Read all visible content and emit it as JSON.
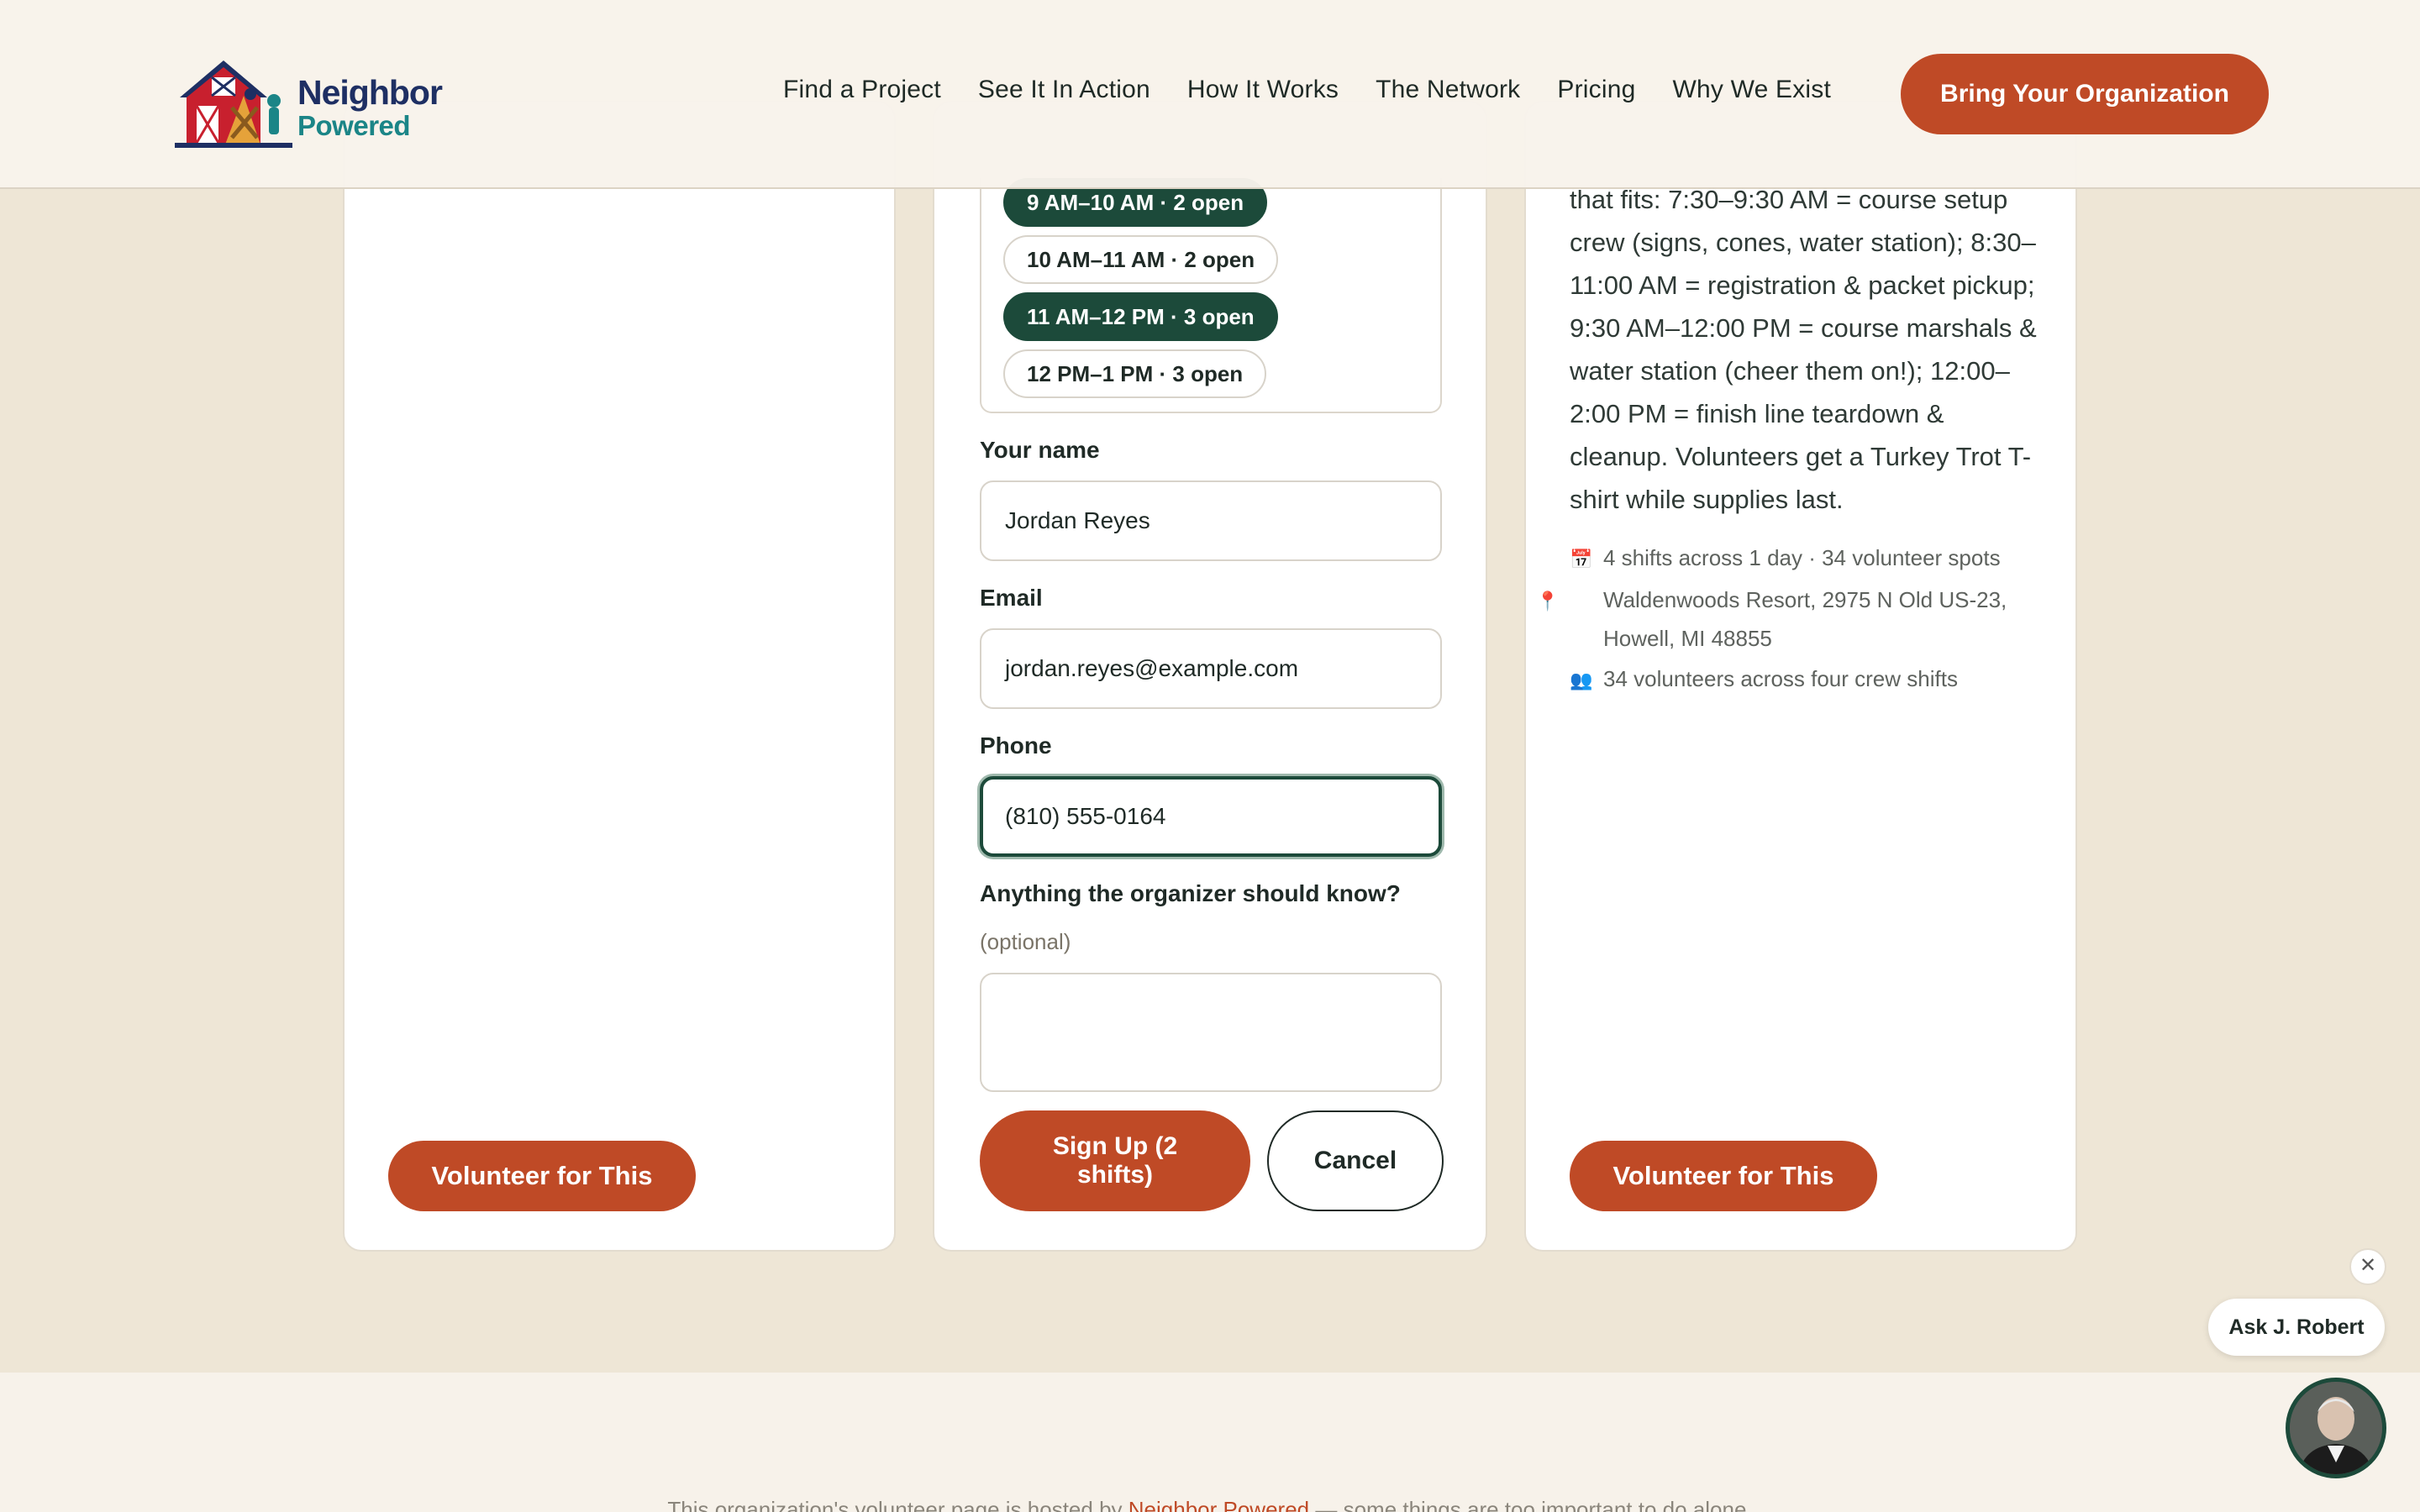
{
  "header": {
    "logo_line1": "Neighbor",
    "logo_line2": "Powered",
    "nav": [
      "Find a Project",
      "See It In Action",
      "How It Works",
      "The Network",
      "Pricing",
      "Why We Exist"
    ],
    "cta": "Bring Your Organization"
  },
  "left_card": {
    "volunteer_label": "Volunteer for This"
  },
  "signup_form": {
    "shifts": [
      {
        "label": "9 AM–10 AM · 2 open",
        "selected": true
      },
      {
        "label": "10 AM–11 AM · 2 open",
        "selected": false
      },
      {
        "label": "11 AM–12 PM · 3 open",
        "selected": true
      },
      {
        "label": "12 PM–1 PM · 3 open",
        "selected": false
      }
    ],
    "name_label": "Your name",
    "name_value": "Jordan Reyes",
    "email_label": "Email",
    "email_value": "jordan.reyes@example.com",
    "phone_label": "Phone",
    "phone_value": "(810) 555-0164",
    "notes_label": "Anything the organizer should know?",
    "notes_optional": "(optional)",
    "notes_value": "",
    "signup_label": "Sign Up (2 shifts)",
    "cancel_label": "Cancel"
  },
  "right_card": {
    "description": "that fits: 7:30–9:30 AM = course setup crew (signs, cones, water station); 8:30–11:00 AM = registration & packet pickup; 9:30 AM–12:00 PM = course marshals & water station (cheer them on!); 12:00–2:00 PM = finish line teardown & cleanup. Volunteers get a Turkey Trot T-shirt while supplies last.",
    "meta_shifts": "4 shifts across 1 day · 34 volunteer spots",
    "meta_location": "Waldenwoods Resort, 2975 N Old US-23, Howell, MI 48855",
    "meta_volunteers": "34 volunteers across four crew shifts",
    "volunteer_label": "Volunteer for This"
  },
  "footer": {
    "text_before": "This organization's volunteer page is hosted by ",
    "brand": "Neighbor Powered",
    "text_after": " — some things are too important to do alone."
  },
  "chat": {
    "bubble_label": "Ask J. Robert",
    "close_symbol": "✕"
  },
  "icons": {
    "calendar": "calendar-icon",
    "location": "pin-icon",
    "people": "people-icon"
  },
  "colors": {
    "accent": "#BF4A26",
    "selected_chip": "#1C4A3A",
    "page_bg": "#EEE6D6"
  }
}
